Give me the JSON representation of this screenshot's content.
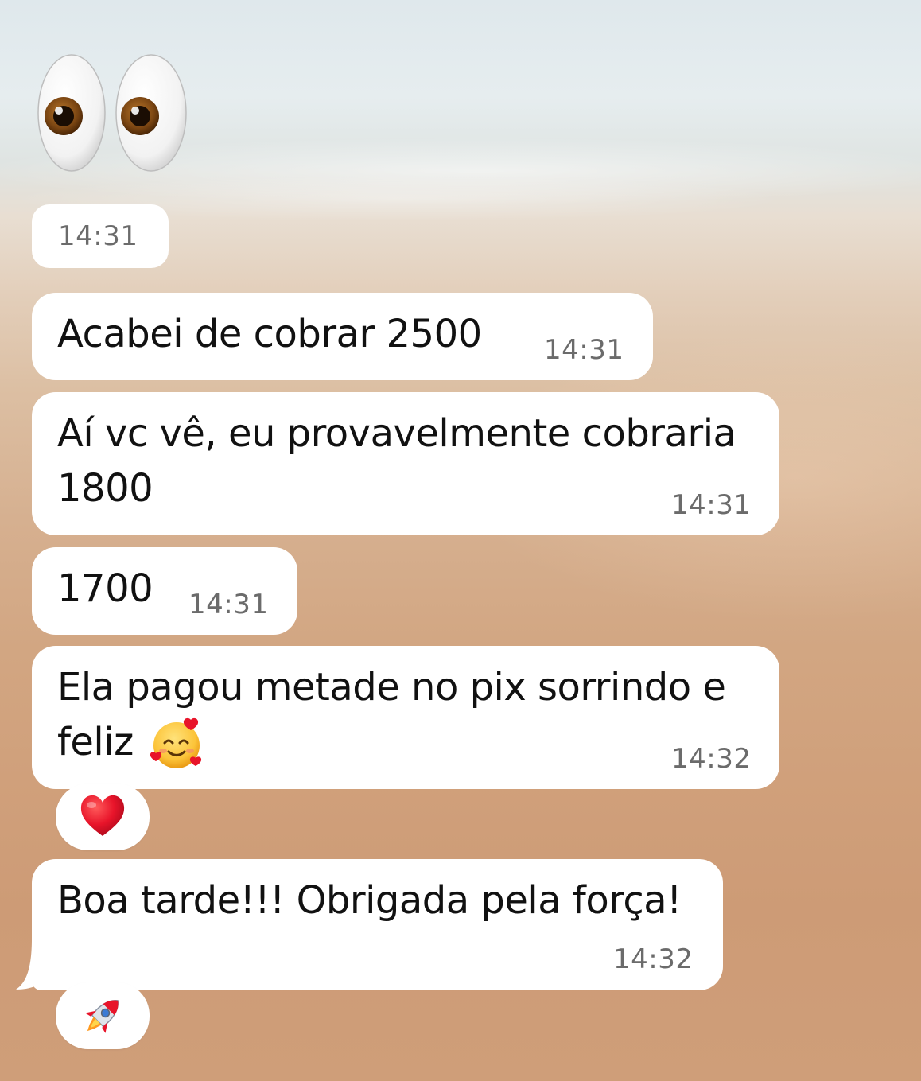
{
  "header_emoji": {
    "name": "eyes"
  },
  "header_time": "14:31",
  "messages": [
    {
      "lines": [
        "Acabei de cobrar 2500"
      ],
      "time": "14:31"
    },
    {
      "lines": [
        "Aí vc vê, eu provavelmente cobraria",
        "1800"
      ],
      "time": "14:31"
    },
    {
      "lines": [
        "1700"
      ],
      "time": "14:31"
    },
    {
      "lines": [
        "Ela pagou metade no pix sorrindo e",
        "feliz"
      ],
      "emoji": "smiling-face-with-hearts",
      "time": "14:32",
      "reaction": "red-heart"
    },
    {
      "lines": [
        "Boa tarde!!! Obrigada pela força!"
      ],
      "time": "14:32",
      "reaction": "rocket"
    }
  ],
  "colors": {
    "bubble": "#ffffff",
    "text": "#111111",
    "timestamp": "#6b6b6b",
    "heart": "#e8142a"
  }
}
